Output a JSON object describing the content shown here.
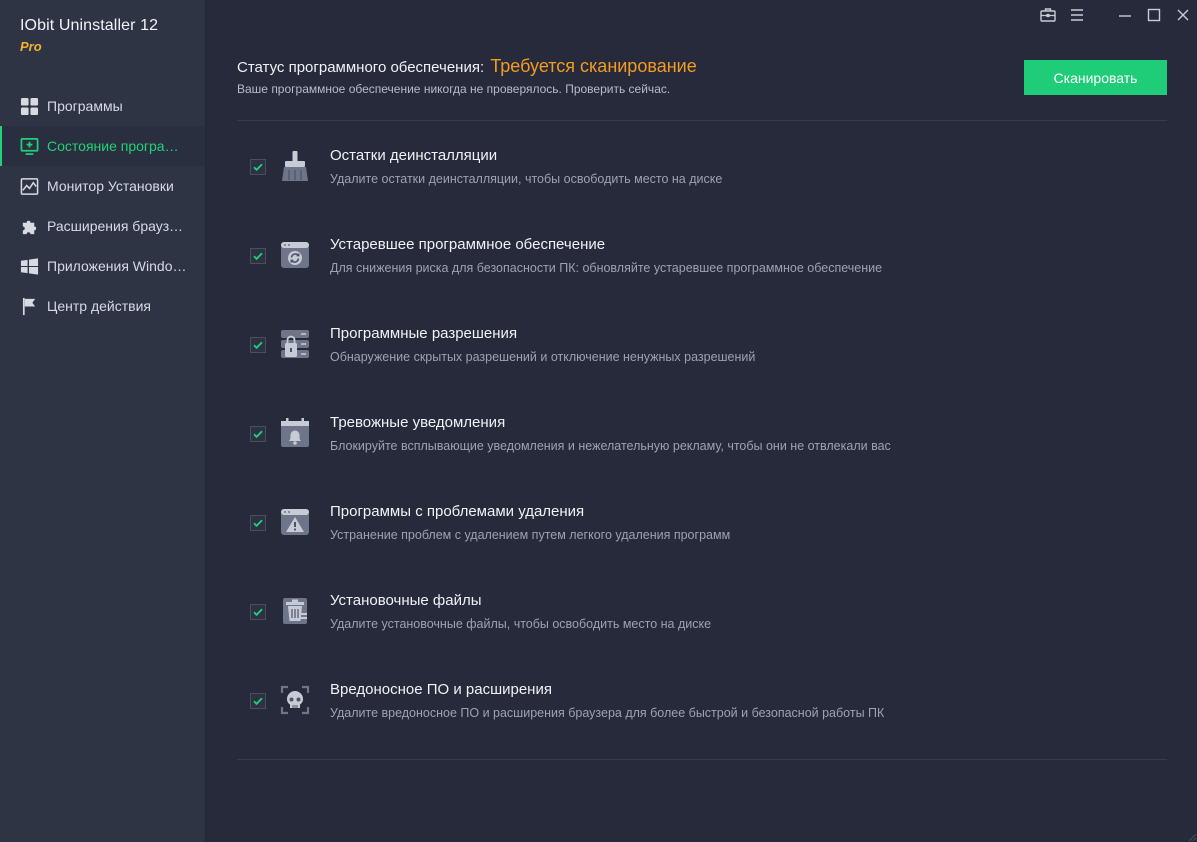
{
  "app": {
    "title": "IObit Uninstaller 12",
    "edition": "Pro"
  },
  "colors": {
    "accent": "#1fcc78",
    "warning": "#f39c1f",
    "edition": "#f2b132"
  },
  "sidebar": {
    "items": [
      {
        "label": "Программы",
        "icon": "grid-icon",
        "active": false
      },
      {
        "label": "Состояние программ...",
        "icon": "software-health-icon",
        "active": true
      },
      {
        "label": "Монитор Установки",
        "icon": "install-monitor-icon",
        "active": false
      },
      {
        "label": "Расширения браузера",
        "icon": "puzzle-icon",
        "active": false
      },
      {
        "label": "Приложения Windows",
        "icon": "windows-logo-icon",
        "active": false
      },
      {
        "label": "Центр действия",
        "icon": "flag-icon",
        "active": false
      }
    ]
  },
  "titlebar": {
    "buttons": [
      "toolbox-icon",
      "menu-icon",
      "minimize-icon",
      "maximize-icon",
      "close-icon"
    ]
  },
  "header": {
    "status_label": "Статус программного обеспечения:",
    "status_value": "Требуется сканирование",
    "subtitle": "Ваше программное обеспечение никогда не проверялось. Проверить сейчас.",
    "scan_button": "Сканировать"
  },
  "items": [
    {
      "title": "Остатки деинсталляции",
      "desc": "Удалите остатки деинсталляции, чтобы освободить место на диске",
      "icon": "broom-icon",
      "checked": true
    },
    {
      "title": "Устаревшее программное обеспечение",
      "desc": "Для снижения риска для безопасности ПК: обновляйте устаревшее программное обеспечение",
      "icon": "outdated-software-icon",
      "checked": true
    },
    {
      "title": "Программные разрешения",
      "desc": "Обнаружение скрытых разрешений и отключение ненужных разрешений",
      "icon": "permissions-lock-icon",
      "checked": true
    },
    {
      "title": "Тревожные уведомления",
      "desc": "Блокируйте всплывающие уведомления и нежелательную рекламу, чтобы они не отвлекали вас",
      "icon": "notification-bell-icon",
      "checked": true
    },
    {
      "title": "Программы с проблемами удаления",
      "desc": "Устранение проблем с удалением путем легкого удаления программ",
      "icon": "warning-window-icon",
      "checked": true
    },
    {
      "title": "Установочные файлы",
      "desc": "Удалите установочные файлы, чтобы освободить место на диске",
      "icon": "setup-files-trash-icon",
      "checked": true
    },
    {
      "title": "Вредоносное ПО и расширения",
      "desc": "Удалите вредоносное ПО и расширения браузера для более быстрой и безопасной работы ПК",
      "icon": "malware-skull-icon",
      "checked": true
    }
  ]
}
